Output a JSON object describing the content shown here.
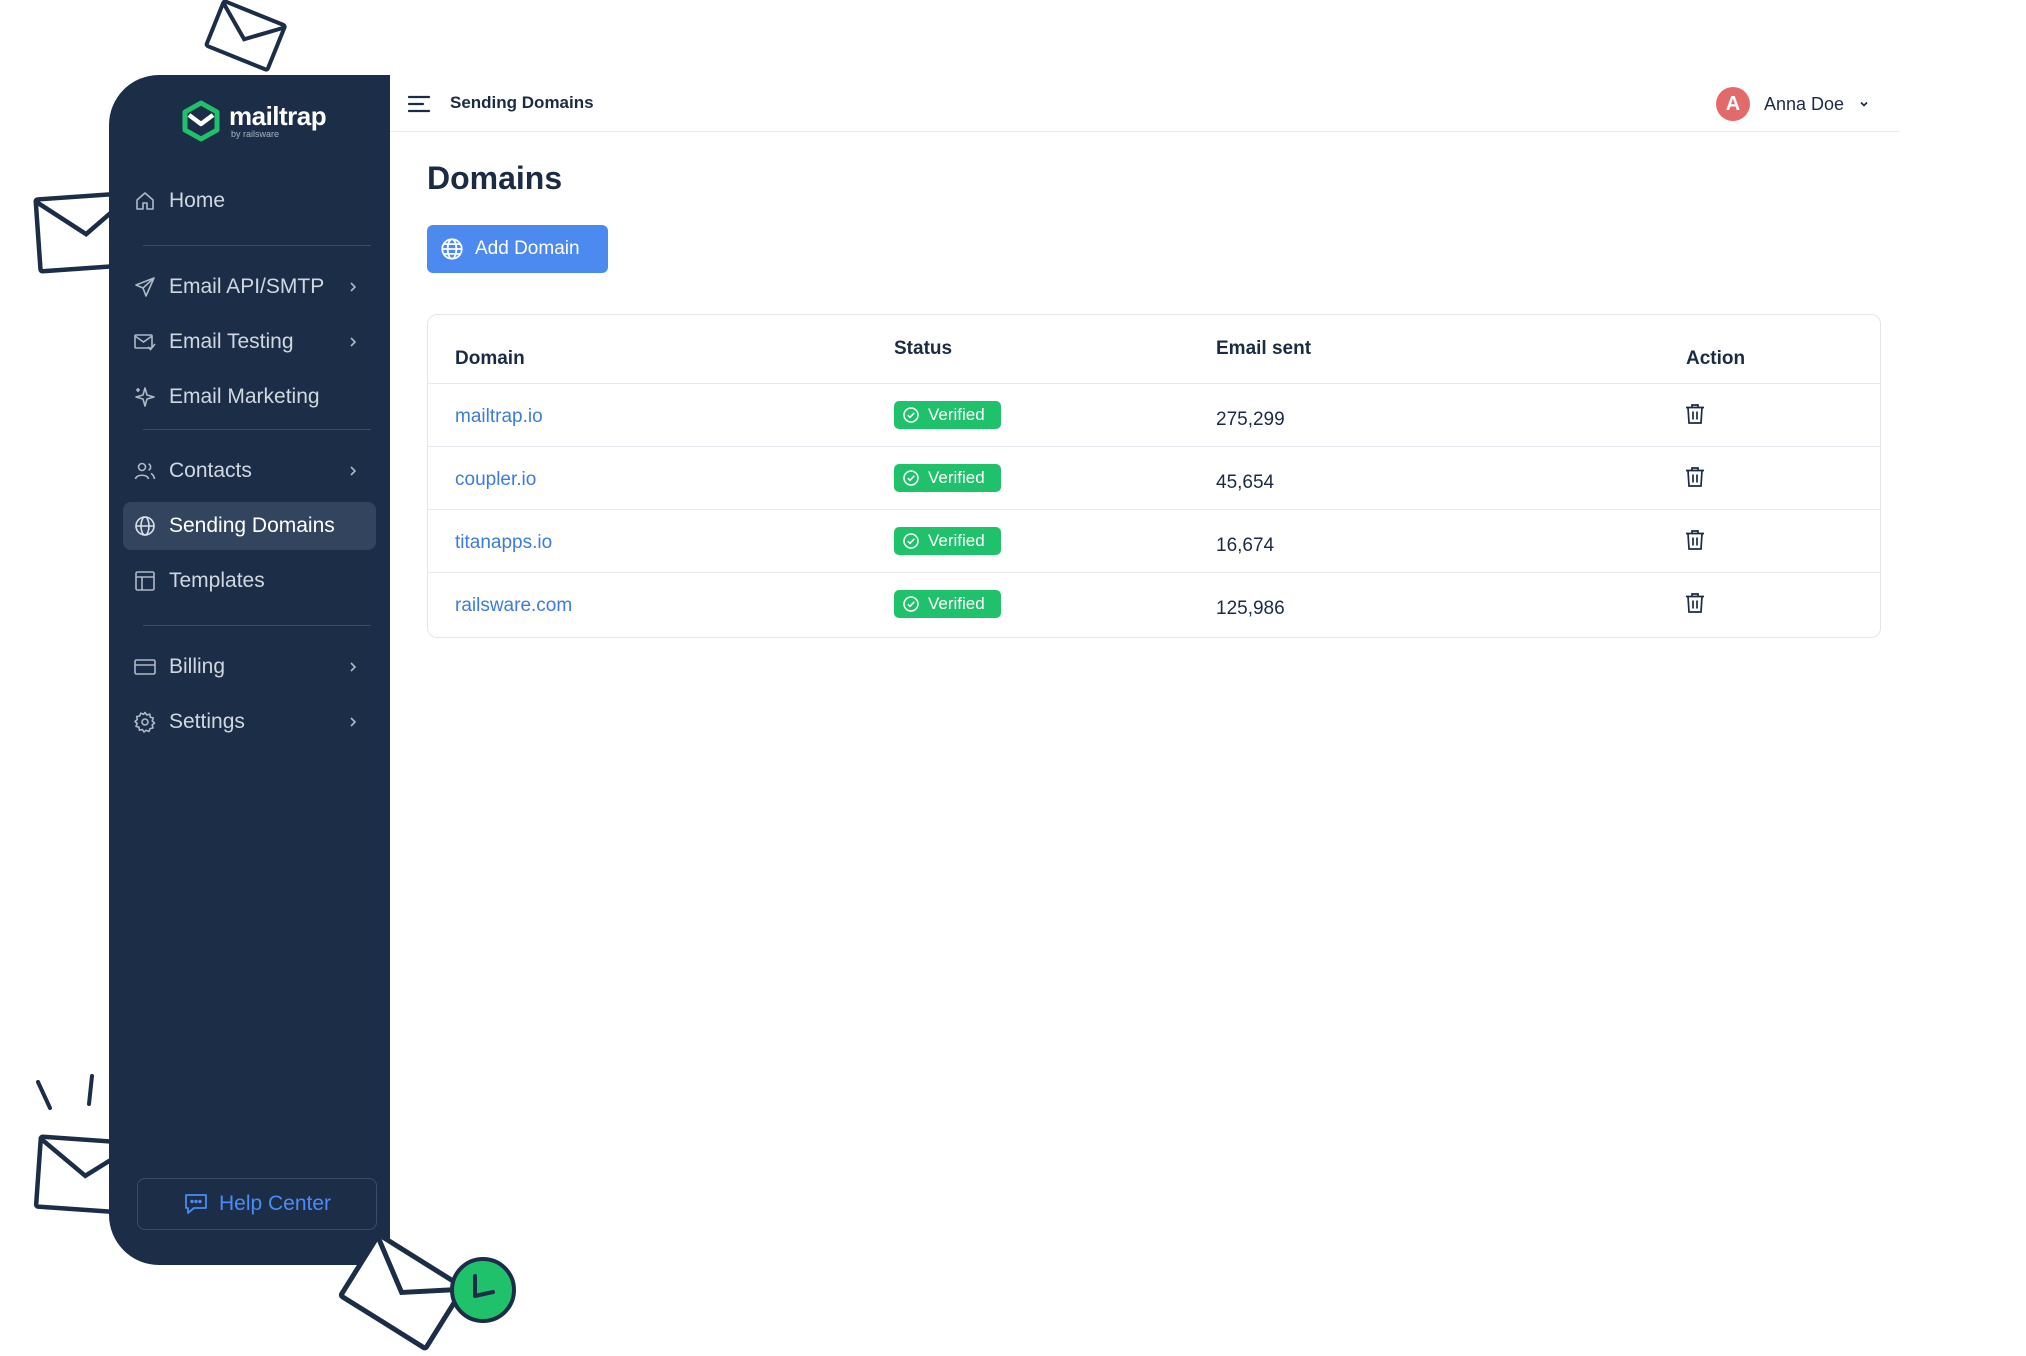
{
  "brand": {
    "name": "mailtrap",
    "sub": "by railsware",
    "accent": "#1fc26b"
  },
  "sidebar": {
    "items": [
      {
        "label": "Home",
        "icon": "home-icon",
        "has_chevron": false
      },
      {
        "label": "Email API/SMTP",
        "icon": "send-icon",
        "has_chevron": true
      },
      {
        "label": "Email Testing",
        "icon": "email-testing-icon",
        "has_chevron": true
      },
      {
        "label": "Email Marketing",
        "icon": "sparkle-icon",
        "has_chevron": false
      },
      {
        "label": "Contacts",
        "icon": "contacts-icon",
        "has_chevron": true
      },
      {
        "label": "Sending Domains",
        "icon": "globe-icon",
        "has_chevron": false,
        "active": true
      },
      {
        "label": "Templates",
        "icon": "template-icon",
        "has_chevron": false
      },
      {
        "label": "Billing",
        "icon": "card-icon",
        "has_chevron": true
      },
      {
        "label": "Settings",
        "icon": "gear-icon",
        "has_chevron": true
      }
    ],
    "help_label": "Help Center"
  },
  "topbar": {
    "breadcrumb": "Sending Domains",
    "user": {
      "initial": "A",
      "name": "Anna Doe",
      "avatar_color": "#e36a6a"
    }
  },
  "main": {
    "title": "Domains",
    "add_button": "Add Domain",
    "table": {
      "headers": {
        "domain": "Domain",
        "status": "Status",
        "sent": "Email sent",
        "action": "Action"
      },
      "rows": [
        {
          "domain": "mailtrap.io",
          "status": "Verified",
          "sent": "275,299"
        },
        {
          "domain": "coupler.io",
          "status": "Verified",
          "sent": "45,654"
        },
        {
          "domain": "titanapps.io",
          "status": "Verified",
          "sent": "16,674"
        },
        {
          "domain": "railsware.com",
          "status": "Verified",
          "sent": "125,986"
        }
      ]
    }
  }
}
